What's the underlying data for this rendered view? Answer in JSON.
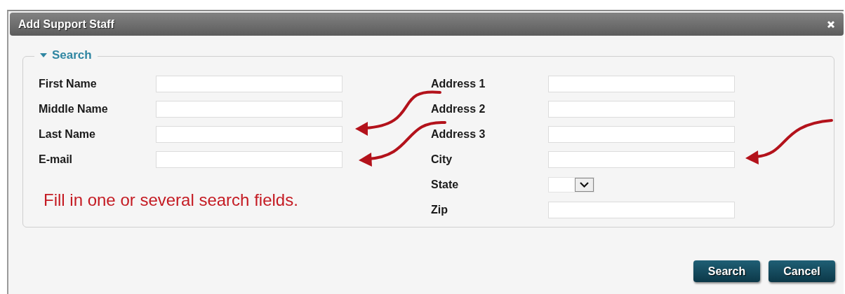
{
  "window": {
    "title": "Add Support Staff"
  },
  "search": {
    "legend": "Search",
    "expanded": true,
    "left_fields": [
      {
        "label": "First Name",
        "kind": "text"
      },
      {
        "label": "Middle Name",
        "kind": "text"
      },
      {
        "label": "Last Name",
        "kind": "text"
      },
      {
        "label": "E-mail",
        "kind": "text"
      }
    ],
    "right_fields": [
      {
        "label": "Address 1",
        "kind": "text"
      },
      {
        "label": "Address 2",
        "kind": "text"
      },
      {
        "label": "Address 3",
        "kind": "text"
      },
      {
        "label": "City",
        "kind": "text"
      },
      {
        "label": "State",
        "kind": "select"
      },
      {
        "label": "Zip",
        "kind": "text"
      }
    ],
    "note": "Fill in one or several search fields."
  },
  "buttons": [
    "Search",
    "Cancel"
  ]
}
